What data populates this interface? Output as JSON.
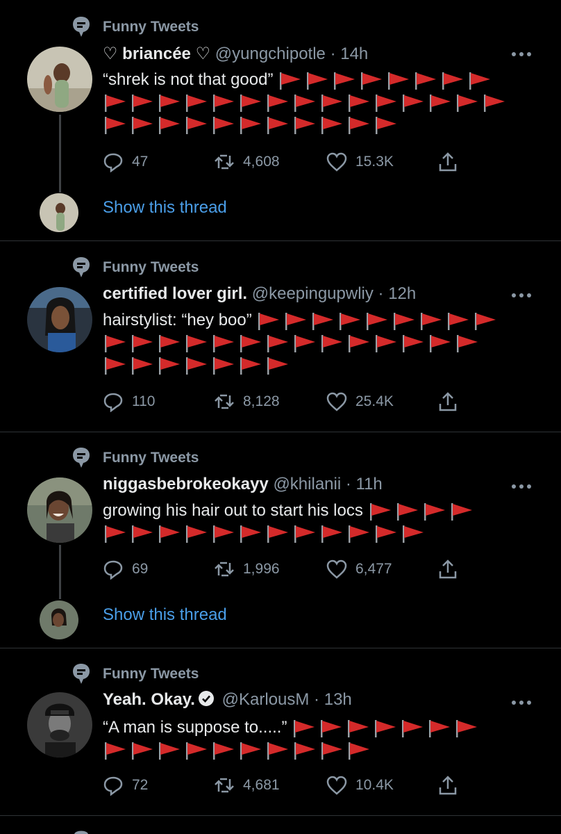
{
  "tweets": [
    {
      "context": "Funny Tweets",
      "name": "♡ briancée ♡",
      "handle": "@yungchipotle",
      "time": "14h",
      "text": "“shrek is not that good”",
      "flag_rows": [
        8,
        15,
        11
      ],
      "replies": "47",
      "retweets": "4,608",
      "likes": "15.3K",
      "show_thread": "Show this thread"
    },
    {
      "context": "Funny Tweets",
      "name": "certified lover girl.",
      "handle": "@keepingupwliy",
      "time": "12h",
      "text": "hairstylist: “hey boo”",
      "flag_rows": [
        9,
        14,
        7
      ],
      "replies": "110",
      "retweets": "8,128",
      "likes": "25.4K"
    },
    {
      "context": "Funny Tweets",
      "name": "niggasbebrokeokayy",
      "handle": "@khilanii",
      "time": "11h",
      "text": "growing his hair out to start his locs",
      "flag_rows": [
        4,
        12
      ],
      "replies": "69",
      "retweets": "1,996",
      "likes": "6,477",
      "show_thread": "Show this thread"
    },
    {
      "context": "Funny Tweets",
      "name": "Yeah. Okay.",
      "handle": "@KarlousM",
      "time": "13h",
      "text": "“A man is suppose to.....”",
      "flag_rows": [
        7,
        10
      ],
      "replies": "72",
      "retweets": "4,681",
      "likes": "10.4K",
      "verified": true
    }
  ],
  "colors": {
    "background": "#000000",
    "text": "#e7e9ea",
    "secondary": "#8b98a5",
    "link": "#4a9ee8",
    "flag_red": "#d42a2a",
    "verified_bg": "#e7e9ea"
  },
  "icons": {
    "context": "speech-bubble-pin-icon",
    "more": "more-horizontal-icon",
    "reply": "reply-icon",
    "retweet": "retweet-icon",
    "like": "heart-icon",
    "share": "share-icon",
    "flag": "triangular-flag-emoji"
  }
}
